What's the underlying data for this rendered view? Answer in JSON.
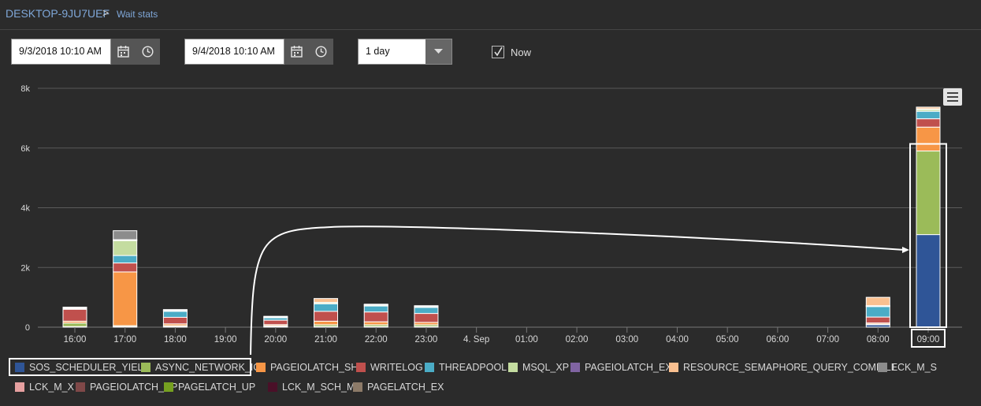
{
  "breadcrumb": {
    "root": "DESKTOP-9JU7UEF",
    "separator": ">",
    "current": "Wait stats"
  },
  "filters": {
    "start": "9/3/2018 10:10 AM",
    "end": "9/4/2018 10:10 AM",
    "range": "1 day",
    "now_label": "Now",
    "now_checked": true
  },
  "chart_data": {
    "type": "bar",
    "stacked": true,
    "ylim": [
      0,
      8000
    ],
    "yticks": [
      "0",
      "2k",
      "4k",
      "6k",
      "8k"
    ],
    "categories": [
      "16:00",
      "17:00",
      "18:00",
      "19:00",
      "20:00",
      "21:00",
      "22:00",
      "23:00",
      "4. Sep",
      "01:00",
      "02:00",
      "03:00",
      "04:00",
      "05:00",
      "06:00",
      "07:00",
      "08:00",
      "09:00"
    ],
    "series": [
      {
        "name": "SOS_SCHEDULER_YIELD",
        "color": "#2f5597",
        "values": [
          20,
          20,
          20,
          0,
          15,
          20,
          20,
          20,
          0,
          0,
          0,
          0,
          0,
          0,
          0,
          0,
          80,
          3100
        ]
      },
      {
        "name": "ASYNC_NETWORK_IO",
        "color": "#9bbb59",
        "values": [
          120,
          30,
          30,
          0,
          30,
          60,
          60,
          60,
          0,
          0,
          0,
          0,
          0,
          0,
          0,
          0,
          20,
          2800
        ]
      },
      {
        "name": "PAGEIOLATCH_SH",
        "color": "#f79646",
        "values": [
          60,
          1800,
          60,
          0,
          40,
          120,
          100,
          80,
          0,
          0,
          0,
          0,
          0,
          0,
          0,
          0,
          40,
          800
        ]
      },
      {
        "name": "WRITELOG",
        "color": "#c0504d",
        "values": [
          400,
          300,
          220,
          0,
          150,
          330,
          330,
          300,
          0,
          0,
          0,
          0,
          0,
          0,
          0,
          0,
          200,
          280
        ]
      },
      {
        "name": "THREADPOOL",
        "color": "#4bacc6",
        "values": [
          20,
          250,
          200,
          0,
          80,
          250,
          200,
          200,
          0,
          0,
          0,
          0,
          0,
          0,
          0,
          0,
          350,
          250
        ]
      },
      {
        "name": "MSQL_XP",
        "color": "#c4dca0",
        "values": [
          20,
          500,
          30,
          0,
          20,
          40,
          30,
          30,
          0,
          0,
          0,
          0,
          0,
          0,
          0,
          0,
          20,
          60
        ]
      },
      {
        "name": "PAGEIOLATCH_EX",
        "color": "#8064a2",
        "values": [
          10,
          10,
          10,
          0,
          10,
          10,
          10,
          10,
          0,
          0,
          0,
          0,
          0,
          0,
          0,
          0,
          10,
          20
        ]
      },
      {
        "name": "RESOURCE_SEMAPHORE_QUERY_COMPILE",
        "color": "#fac090",
        "values": [
          20,
          20,
          20,
          0,
          20,
          130,
          20,
          20,
          0,
          0,
          0,
          0,
          0,
          0,
          0,
          0,
          280,
          60
        ]
      },
      {
        "name": "LCK_M_S",
        "color": "#8c8c8c",
        "values": [
          0,
          300,
          0,
          0,
          0,
          0,
          0,
          0,
          0,
          0,
          0,
          0,
          0,
          0,
          0,
          0,
          0,
          0
        ]
      },
      {
        "name": "LCK_M_X",
        "color": "#e6a0a0",
        "values": [
          0,
          0,
          0,
          0,
          0,
          0,
          0,
          0,
          0,
          0,
          0,
          0,
          0,
          0,
          0,
          0,
          0,
          0
        ]
      },
      {
        "name": "PAGEIOLATCH_UP",
        "color": "#7f4848",
        "values": [
          0,
          0,
          0,
          0,
          0,
          0,
          0,
          0,
          0,
          0,
          0,
          0,
          0,
          0,
          0,
          0,
          0,
          0
        ]
      },
      {
        "name": "PAGELATCH_UP",
        "color": "#76a020",
        "values": [
          0,
          0,
          0,
          0,
          0,
          0,
          0,
          0,
          0,
          0,
          0,
          0,
          0,
          0,
          0,
          0,
          0,
          0
        ]
      },
      {
        "name": "LCK_M_SCH_M",
        "color": "#4a1028",
        "values": [
          0,
          0,
          0,
          0,
          0,
          0,
          0,
          0,
          0,
          0,
          0,
          0,
          0,
          0,
          0,
          0,
          0,
          0
        ]
      },
      {
        "name": "PAGELATCH_EX",
        "color": "#8c7a68",
        "values": [
          0,
          0,
          0,
          0,
          0,
          0,
          0,
          0,
          0,
          0,
          0,
          0,
          0,
          0,
          0,
          0,
          0,
          0
        ]
      }
    ],
    "highlight_category": "09:00",
    "highlight_series": [
      "SOS_SCHEDULER_YIELD",
      "ASYNC_NETWORK_IO"
    ]
  }
}
